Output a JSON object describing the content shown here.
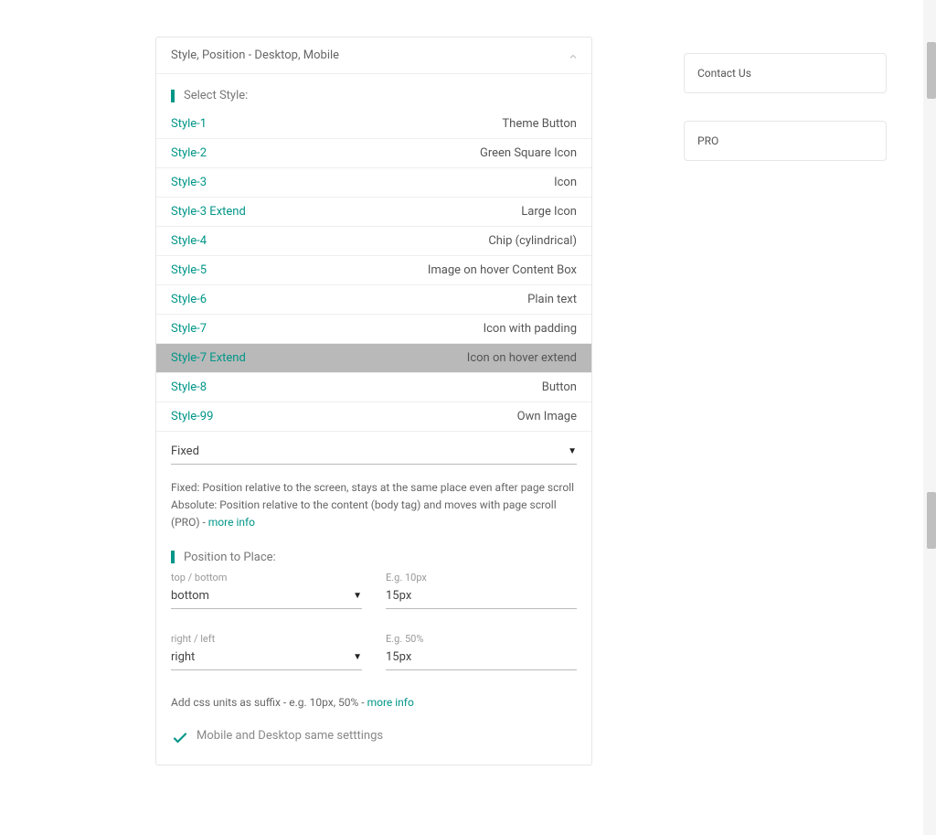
{
  "header": {
    "title": "Style, Position - Desktop, Mobile"
  },
  "selectStyle": {
    "heading": "Select Style:",
    "items": [
      {
        "name": "Style-1",
        "desc": "Theme Button",
        "selected": false
      },
      {
        "name": "Style-2",
        "desc": "Green Square Icon",
        "selected": false
      },
      {
        "name": "Style-3",
        "desc": "Icon",
        "selected": false
      },
      {
        "name": "Style-3 Extend",
        "desc": "Large Icon",
        "selected": false
      },
      {
        "name": "Style-4",
        "desc": "Chip (cylindrical)",
        "selected": false
      },
      {
        "name": "Style-5",
        "desc": "Image on hover Content Box",
        "selected": false
      },
      {
        "name": "Style-6",
        "desc": "Plain text",
        "selected": false
      },
      {
        "name": "Style-7",
        "desc": "Icon with padding",
        "selected": false
      },
      {
        "name": "Style-7 Extend",
        "desc": "Icon on hover extend",
        "selected": true
      },
      {
        "name": "Style-8",
        "desc": "Button",
        "selected": false
      },
      {
        "name": "Style-99",
        "desc": "Own Image",
        "selected": false
      }
    ]
  },
  "positionType": {
    "value": "Fixed",
    "help_fixed": "Fixed: Position relative to the screen, stays at the same place even after page scroll",
    "help_absolute": "Absolute: Position relative to the content (body tag) and moves with page scroll (PRO) - ",
    "more_info": "more info"
  },
  "positionPlace": {
    "heading": "Position to Place:",
    "row1": {
      "label1": "top / bottom",
      "value1": "bottom",
      "label2": "E.g. 10px",
      "value2": "15px"
    },
    "row2": {
      "label1": "right / left",
      "value1": "right",
      "label2": "E.g. 50%",
      "value2": "15px"
    },
    "suffix_help": "Add css units as suffix - e.g. 10px, 50% - ",
    "more_info": "more info"
  },
  "mobile": {
    "same_label": "Mobile and Desktop same setttings"
  },
  "sidebar": {
    "contact": "Contact Us",
    "pro": "PRO"
  }
}
